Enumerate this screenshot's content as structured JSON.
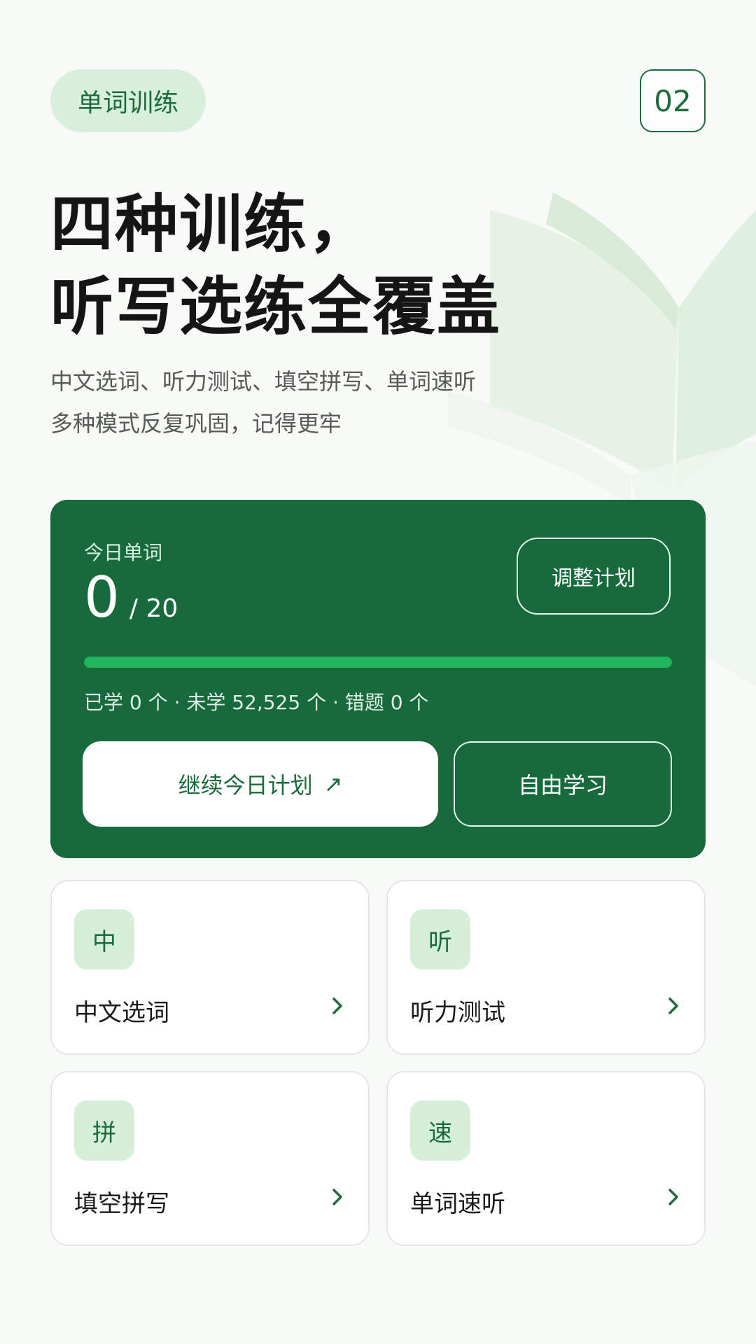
{
  "header": {
    "tag": "单词训练",
    "page_number": "02"
  },
  "hero": {
    "title_line1": "四种训练，",
    "title_line2": "听写选练全覆盖",
    "subtitle_line1": "中文选词、听力测试、填空拼写、单词速听",
    "subtitle_line2": "多种模式反复巩固，记得更牢"
  },
  "plan": {
    "label": "今日单词",
    "learned_today": "0",
    "daily_goal": "/ 20",
    "progress_fraction": 1.0,
    "adjust_label": "调整计划",
    "stats": "已学 0 个 · 未学 52,525 个 · 错题 0 个",
    "continue_label": "继续今日计划",
    "continue_arrow": "↗",
    "free_study_label": "自由学习"
  },
  "modes": [
    {
      "badge": "中",
      "title": "中文选词",
      "icon": "chevron-right-icon"
    },
    {
      "badge": "听",
      "title": "听力测试",
      "icon": "chevron-right-icon"
    },
    {
      "badge": "拼",
      "title": "填空拼写",
      "icon": "chevron-right-icon"
    },
    {
      "badge": "速",
      "title": "单词速听",
      "icon": "chevron-right-icon"
    }
  ],
  "colors": {
    "brand_green": "#166a3c",
    "accent_green": "#22b45a",
    "badge_bg": "#d6efd9",
    "background": "#f8faf7"
  }
}
